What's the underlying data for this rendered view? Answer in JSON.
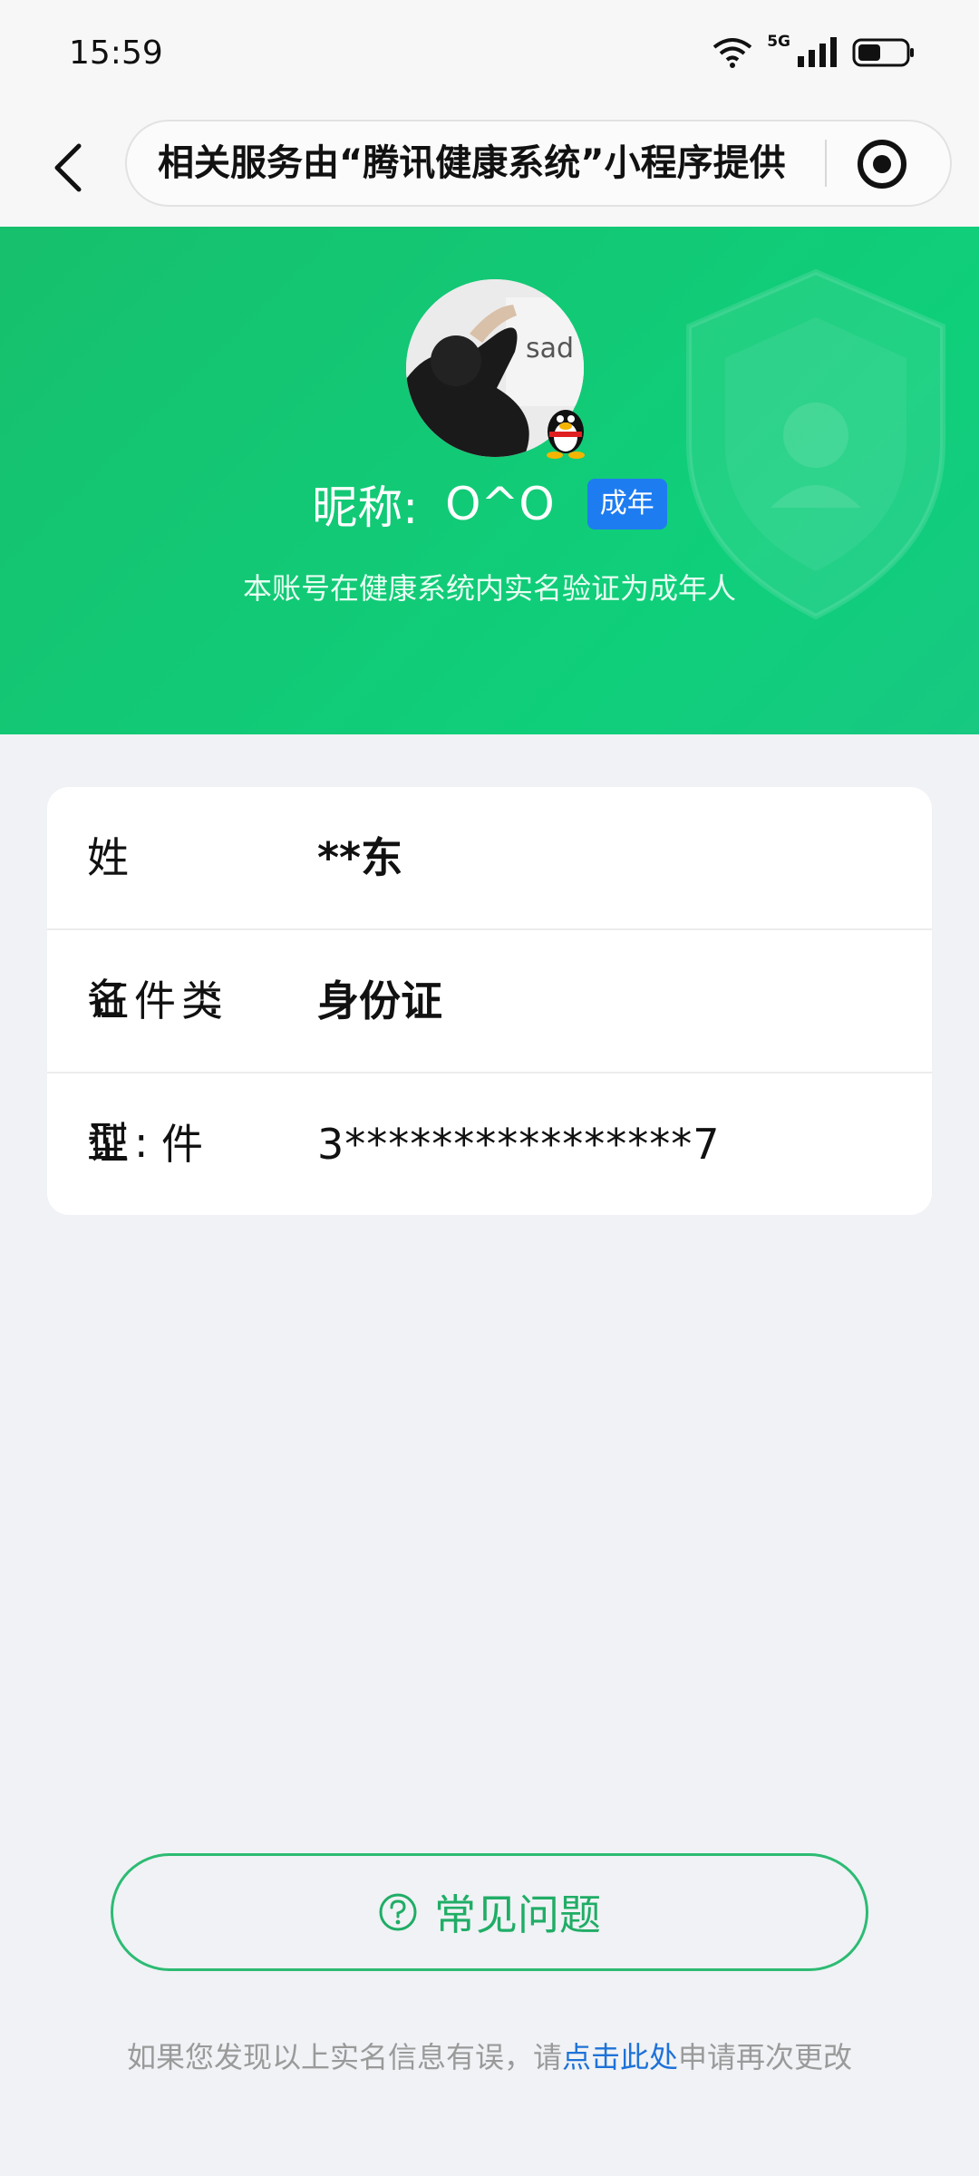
{
  "status_bar": {
    "time": "15:59",
    "network": "5G",
    "icons": [
      "wifi-icon",
      "signal-icon",
      "battery-icon"
    ]
  },
  "nav": {
    "title": "相关服务由“腾讯健康系统”小程序提供",
    "back_icon": "chevron-left-icon",
    "menu_icon": "target-icon"
  },
  "profile": {
    "nickname_label": "昵称:",
    "nickname": "O^O",
    "badge": "成年",
    "verify_text": "本账号在健康系统内实名验证为成年人"
  },
  "info": {
    "name_label": "姓名:",
    "name_value": "**东",
    "id_type_label": "证件类型:",
    "id_type_value": "身份证",
    "id_number_label": "证件号:",
    "id_number_value": "3****************7"
  },
  "faq": {
    "label": "常见问题",
    "icon": "question-circle-icon"
  },
  "footer": {
    "prefix": "如果您发现以上实名信息有误，请",
    "link": "点击此处",
    "suffix": "申请再次更改"
  },
  "colors": {
    "primary_green": "#18bd6a",
    "badge_blue": "#1e7cf1",
    "link_blue": "#1e72d8",
    "background": "#f0f2f5"
  }
}
